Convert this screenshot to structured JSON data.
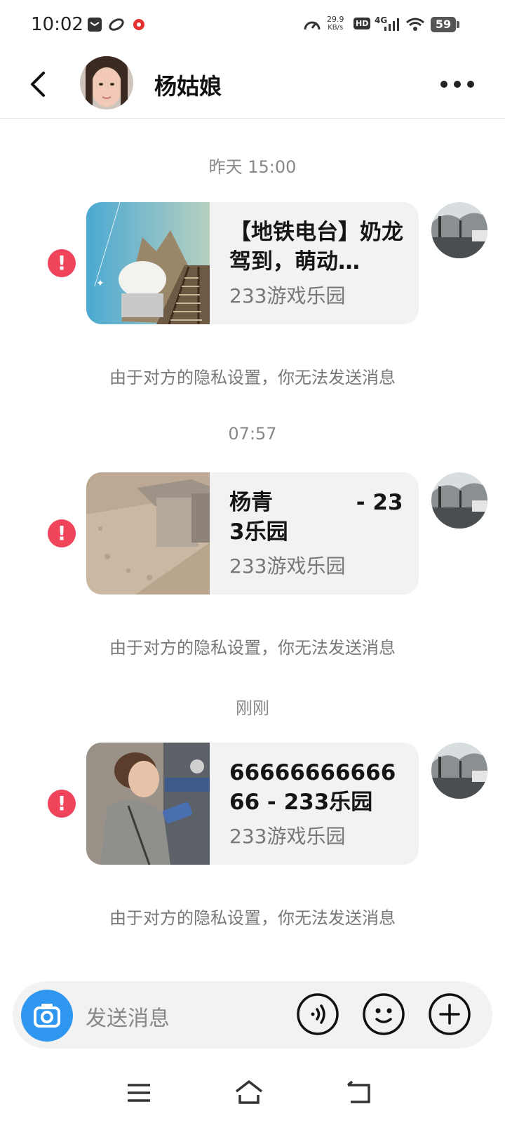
{
  "status_bar": {
    "time": "10:02",
    "speed_value": "29.9",
    "speed_unit": "KB/s",
    "hd": "HD",
    "network": "4G",
    "battery": "59"
  },
  "header": {
    "back_icon": "chevron-left-icon",
    "title": "杨姑娘",
    "more_icon": "more-horizontal-icon"
  },
  "messages": [
    {
      "time": "昨天 15:00",
      "card_title": "【地铁电台】奶龙驾到，萌动…",
      "card_source": "233游戏乐园",
      "status_icon": "error-icon",
      "notice": "由于对方的隐私设置，你无法发送消息"
    },
    {
      "time": "07:57",
      "card_title": "杨青           - 233乐园",
      "card_source": "233游戏乐园",
      "status_icon": "error-icon",
      "notice": "由于对方的隐私设置，你无法发送消息"
    },
    {
      "time": "刚刚",
      "card_title": "6666666666666 - 233乐园",
      "card_source": "233游戏乐园",
      "status_icon": "error-icon",
      "notice": "由于对方的隐私设置，你无法发送消息"
    }
  ],
  "input_bar": {
    "placeholder": "发送消息",
    "camera_icon": "camera-icon",
    "voice_icon": "voice-icon",
    "emoji_icon": "emoji-icon",
    "plus_icon": "plus-icon"
  },
  "nav_bar": {
    "menu_icon": "menu-icon",
    "home_icon": "home-icon",
    "back_icon": "back-icon"
  },
  "colors": {
    "accent": "#2f97f0",
    "error": "#f0445a",
    "bubble": "#f2f2f2"
  }
}
